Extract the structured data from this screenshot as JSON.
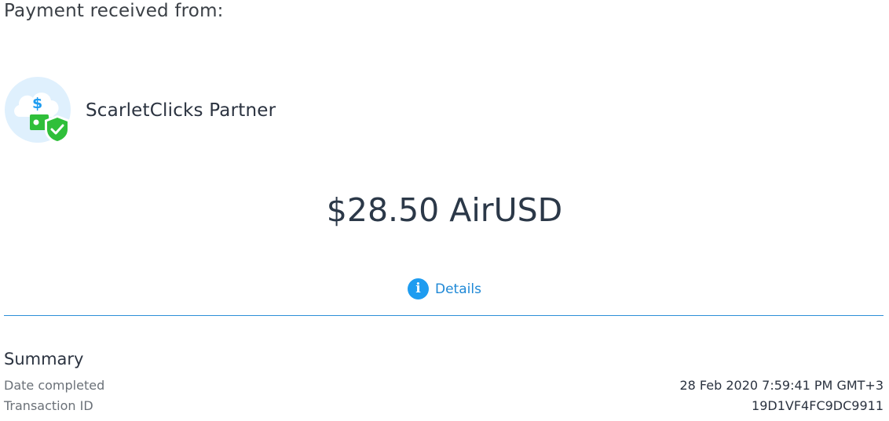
{
  "header": {
    "title": "Payment received from:"
  },
  "sender": {
    "name": "ScarletClicks Partner",
    "logo_icon": "money-shield-icon",
    "logo_symbol": "$"
  },
  "payment": {
    "amount": "$28.50 AirUSD"
  },
  "details": {
    "icon": "info-icon",
    "icon_glyph": "i",
    "label": "Details"
  },
  "summary": {
    "title": "Summary",
    "date_label": "Date completed",
    "date_value": "28 Feb 2020 7:59:41 PM GMT+3",
    "tx_label": "Transaction ID",
    "tx_value": "19D1VF4FC9DC9911"
  },
  "colors": {
    "accent": "#1e9cf0",
    "divider": "#2d8fd8",
    "logo_bg": "#dff0fd",
    "logo_green": "#2fbf3a",
    "text": "#2b3340"
  }
}
